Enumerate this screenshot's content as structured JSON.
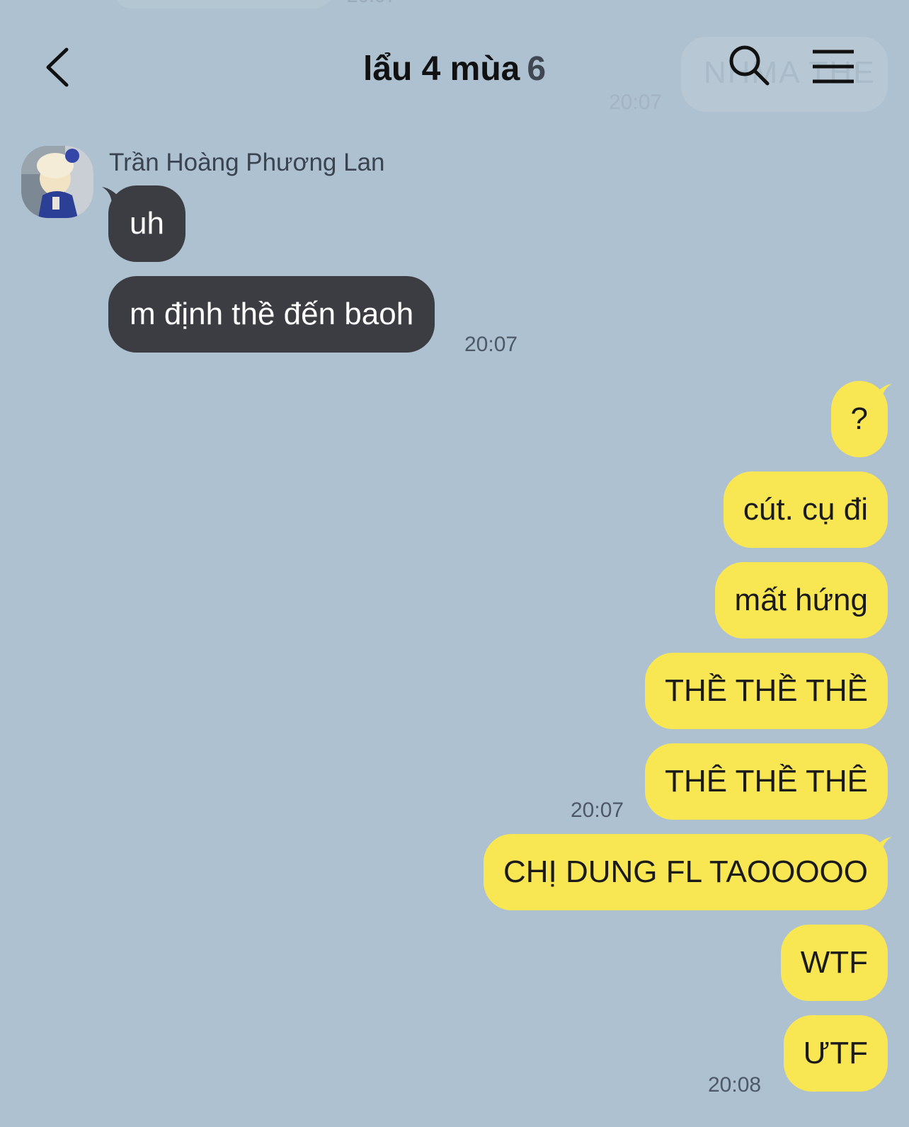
{
  "background_color": "#aec1d0",
  "colors": {
    "incoming_bubble": "#3b3d42",
    "outgoing_bubble": "#f8e653"
  },
  "header": {
    "title": "lẩu 4 mùa",
    "member_count": "6",
    "icons": [
      "back-arrow-icon",
      "search-icon",
      "menu-icon"
    ]
  },
  "ghost": {
    "text": "NHMA THE",
    "time": "20:07",
    "top_time": "20:07"
  },
  "incoming": {
    "sender": "Trần Hoàng Phương Lan",
    "messages": [
      "uh",
      "m định thề đến baoh"
    ],
    "time": "20:07"
  },
  "outgoing": {
    "messages": [
      "?",
      "cút. cụ đi",
      "mất hứng",
      "THỀ THỀ THỀ",
      "THÊ THỀ THÊ",
      "CHỊ DUNG FL TAOOOOO",
      "WTF",
      "ƯTF"
    ],
    "time_1": "20:07",
    "time_2": "20:08"
  }
}
